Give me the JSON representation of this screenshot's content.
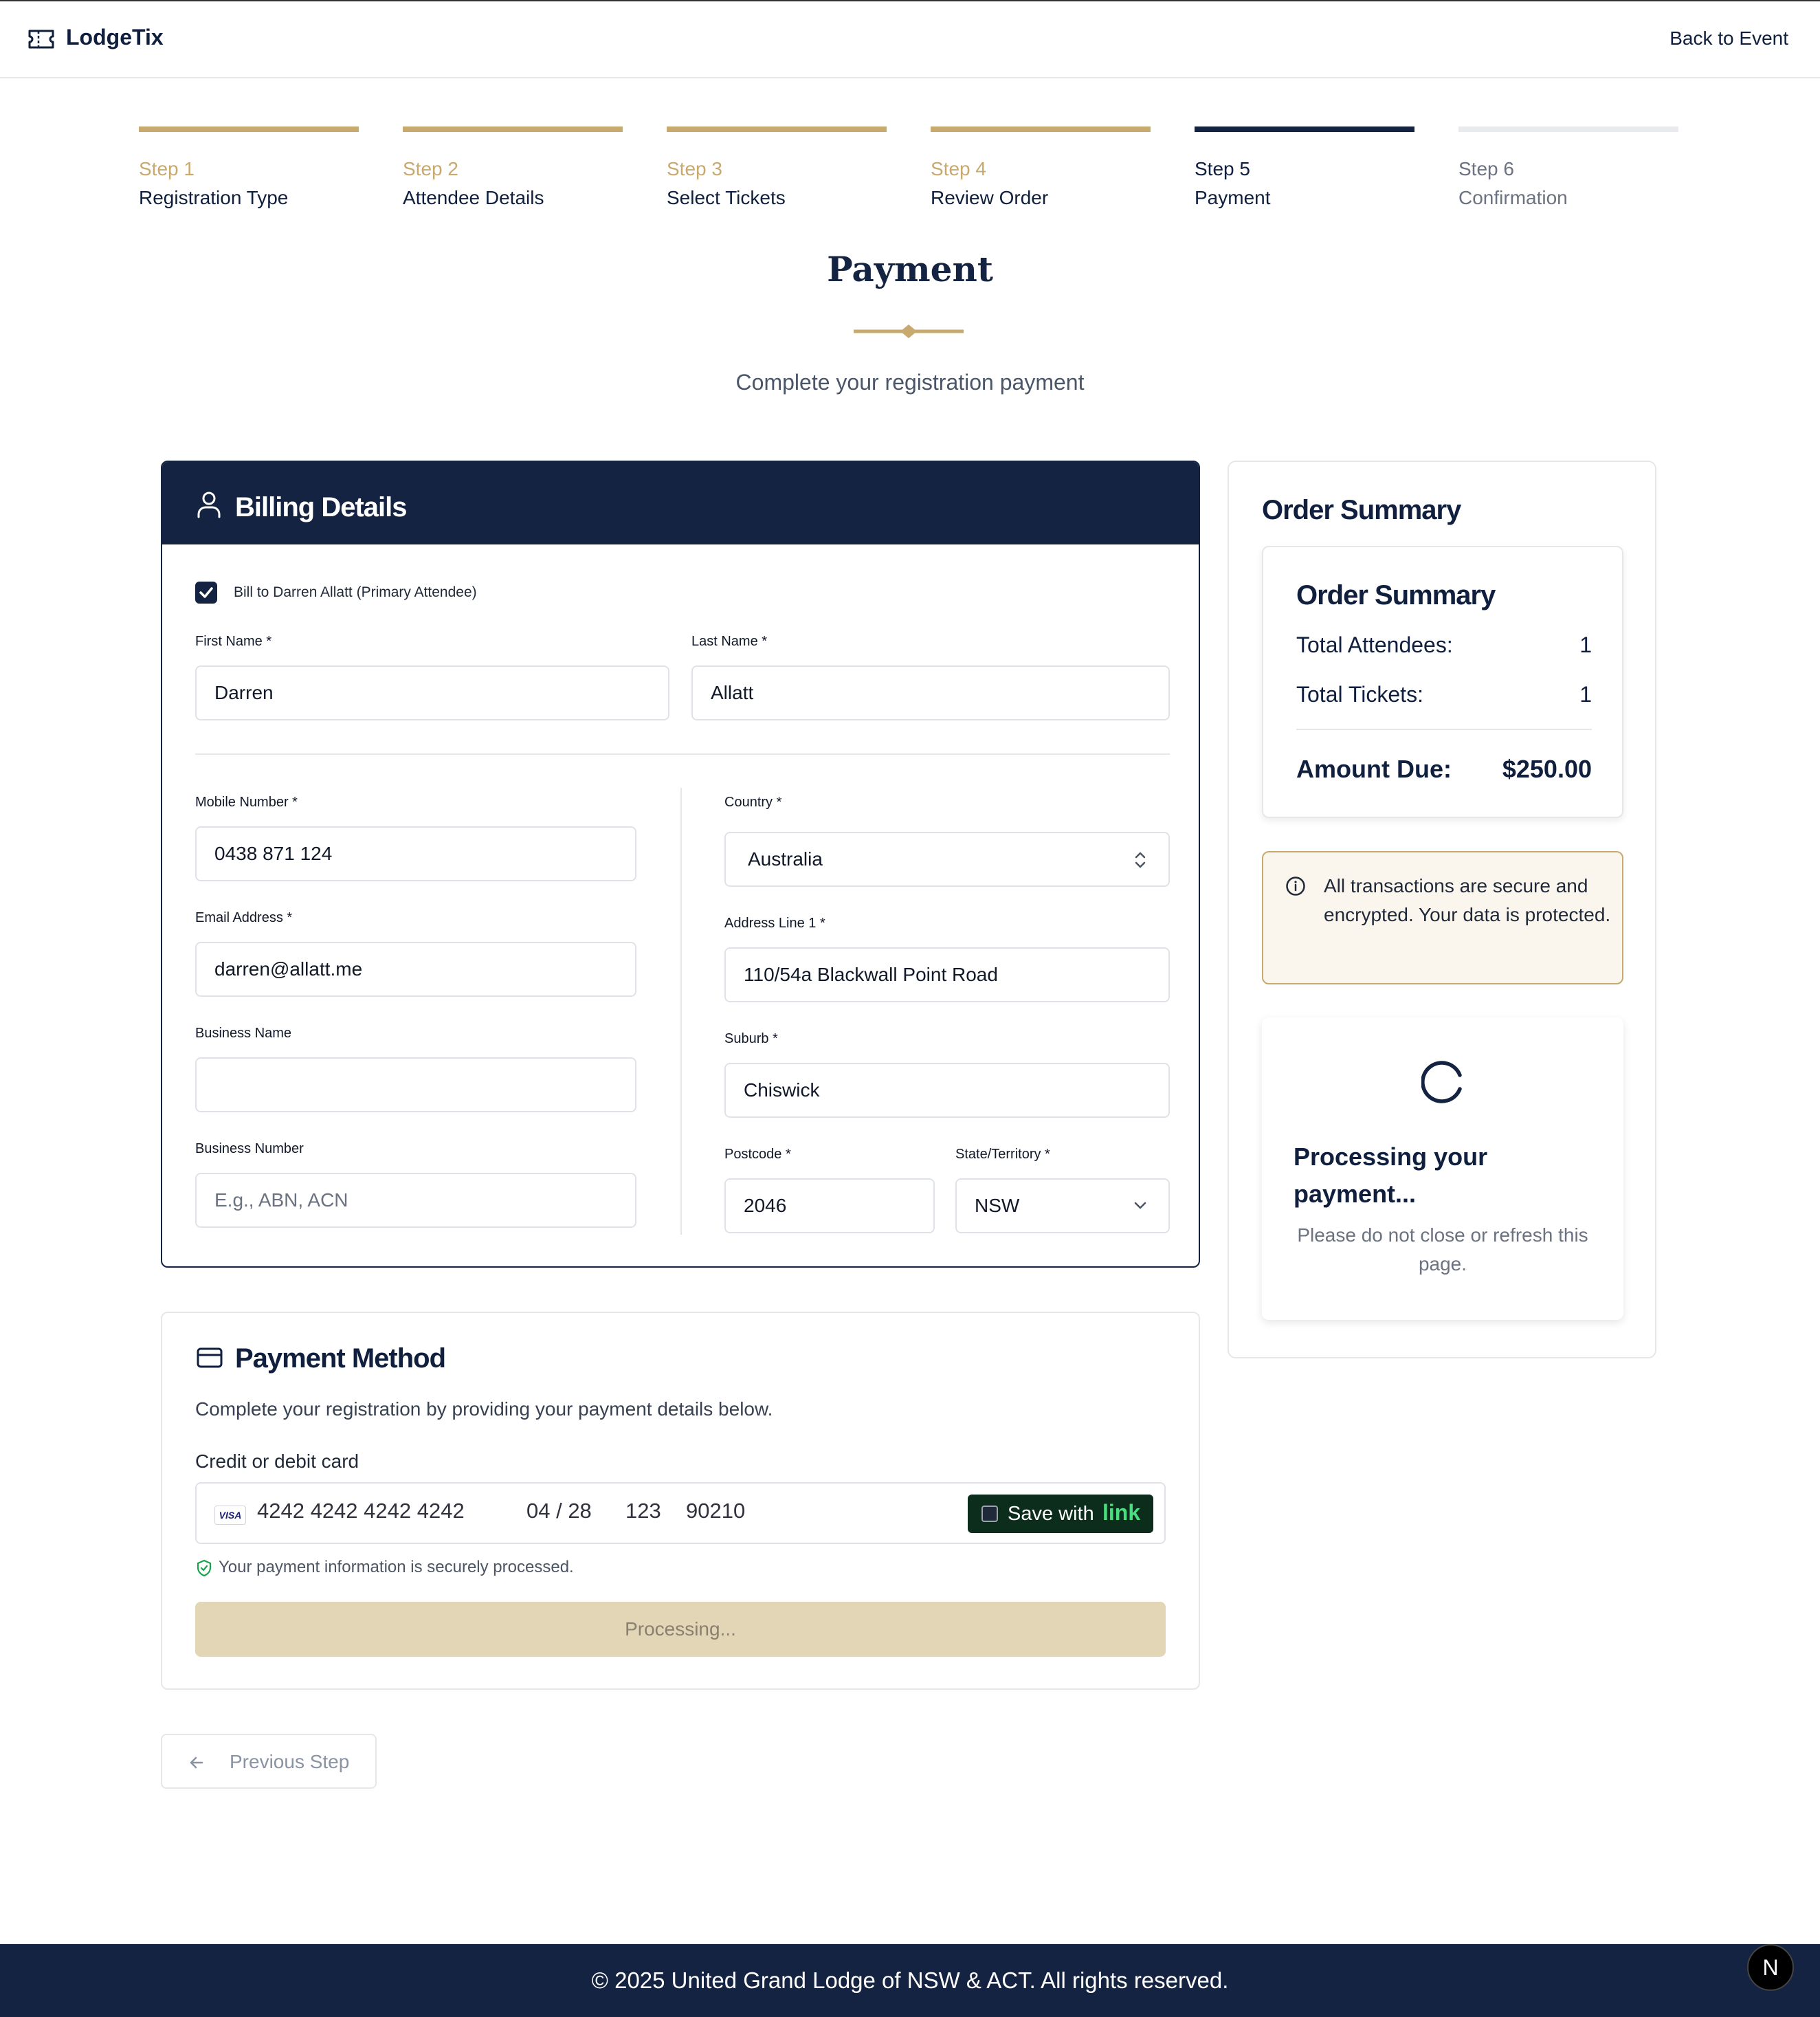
{
  "header": {
    "brand": "LodgeTix",
    "back_link": "Back to Event"
  },
  "steps": [
    {
      "num": "Step 1",
      "label": "Registration Type",
      "state": "complete"
    },
    {
      "num": "Step 2",
      "label": "Attendee Details",
      "state": "complete"
    },
    {
      "num": "Step 3",
      "label": "Select Tickets",
      "state": "complete"
    },
    {
      "num": "Step 4",
      "label": "Review Order",
      "state": "complete"
    },
    {
      "num": "Step 5",
      "label": "Payment",
      "state": "active"
    },
    {
      "num": "Step 6",
      "label": "Confirmation",
      "state": "pending"
    }
  ],
  "page": {
    "title": "Payment",
    "subtitle": "Complete your registration payment"
  },
  "billing": {
    "title": "Billing Details",
    "bill_to_label": "Bill to Darren Allatt (Primary Attendee)",
    "bill_to_checked": true,
    "first_name": {
      "label": "First Name *",
      "value": "Darren"
    },
    "last_name": {
      "label": "Last Name *",
      "value": "Allatt"
    },
    "mobile": {
      "label": "Mobile Number *",
      "value": "0438 871 124"
    },
    "email": {
      "label": "Email Address *",
      "value": "darren@allatt.me"
    },
    "business_name": {
      "label": "Business Name",
      "value": ""
    },
    "business_number": {
      "label": "Business Number",
      "placeholder": "E.g., ABN, ACN"
    },
    "country": {
      "label": "Country *",
      "value": "Australia"
    },
    "address1": {
      "label": "Address Line 1 *",
      "value": "110/54a Blackwall Point Road"
    },
    "suburb": {
      "label": "Suburb *",
      "value": "Chiswick"
    },
    "postcode": {
      "label": "Postcode *",
      "value": "2046"
    },
    "state": {
      "label": "State/Territory *",
      "value": "NSW"
    }
  },
  "payment": {
    "title": "Payment Method",
    "description": "Complete your registration by providing your payment details below.",
    "card_label": "Credit or debit card",
    "card_brand": "VISA",
    "card_number": "4242 4242 4242 4242",
    "expiry": "04 / 28",
    "cvc": "123",
    "zip": "90210",
    "save_with": "Save with",
    "link_brand": "link",
    "secure_note": "Your payment information is securely processed.",
    "submit_label": "Processing..."
  },
  "nav": {
    "previous": "Previous Step"
  },
  "summary": {
    "outer_title": "Order Summary",
    "inner_title": "Order Summary",
    "attendees_label": "Total Attendees:",
    "attendees_value": "1",
    "tickets_label": "Total Tickets:",
    "tickets_value": "1",
    "due_label": "Amount Due:",
    "due_value": "$250.00",
    "secure_message": "All transactions are secure and encrypted. Your data is protected.",
    "processing_title": "Processing your payment...",
    "processing_message": "Please do not close or refresh this page."
  },
  "footer": {
    "copyright": "© 2025 United Grand Lodge of NSW & ACT. All rights reserved.",
    "badge": "N"
  },
  "colors": {
    "navy": "#142342",
    "gold": "#c8a96e",
    "processing_button": "#e3d6b7",
    "link_green": "#4ade80"
  }
}
